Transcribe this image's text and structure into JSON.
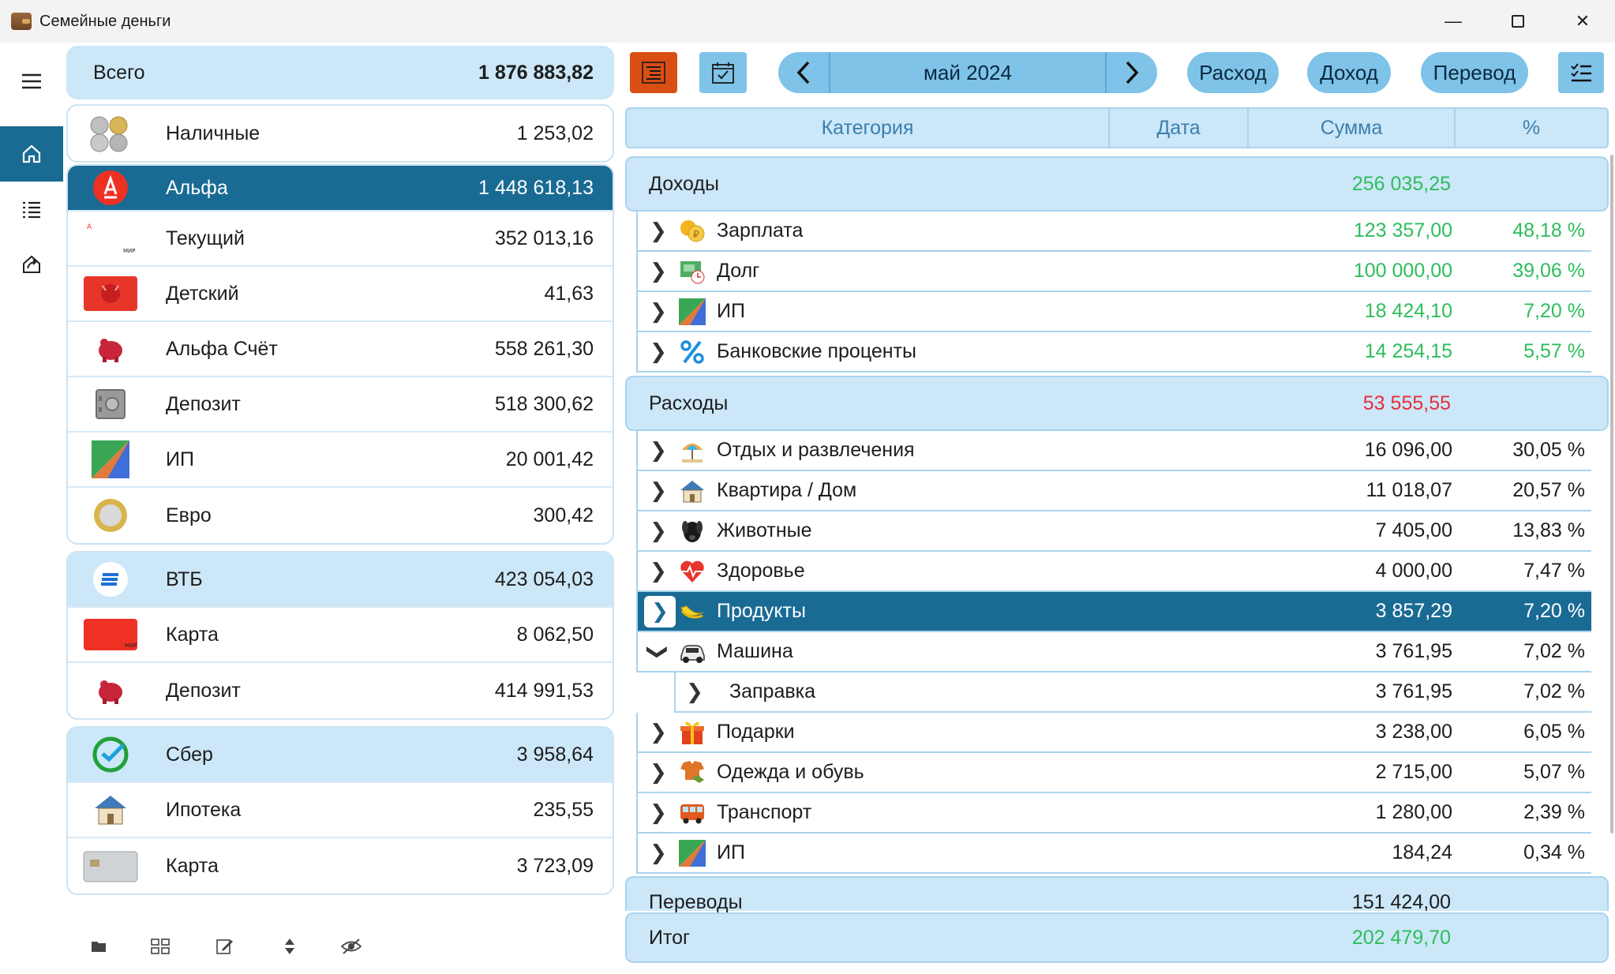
{
  "window": {
    "title": "Семейные деньги"
  },
  "accounts": {
    "total_label": "Всего",
    "total_value": "1 876 883,82",
    "groups": [
      {
        "rows": [
          {
            "name": "Наличные",
            "value": "1 253,02",
            "icon": "coins-icon"
          }
        ]
      },
      {
        "rows": [
          {
            "name": "Альфа",
            "value": "1 448 618,13",
            "icon": "alfa-bank-logo-icon",
            "bank": true,
            "selected": true
          },
          {
            "name": "Текущий",
            "value": "352 013,16",
            "icon": "card-icon"
          },
          {
            "name": "Детский",
            "value": "41,63",
            "icon": "red-cat-card-icon"
          },
          {
            "name": "Альфа Счёт",
            "value": "558 261,30",
            "icon": "piggy-bank-icon"
          },
          {
            "name": "Депозит",
            "value": "518 300,62",
            "icon": "safe-icon"
          },
          {
            "name": "ИП",
            "value": "20 001,42",
            "icon": "ip-triangle-icon"
          },
          {
            "name": "Евро",
            "value": "300,42",
            "icon": "euro-coin-icon"
          }
        ]
      },
      {
        "rows": [
          {
            "name": "ВТБ",
            "value": "423 054,03",
            "icon": "vtb-logo-icon",
            "bank": true
          },
          {
            "name": "Карта",
            "value": "8 062,50",
            "icon": "red-card-icon"
          },
          {
            "name": "Депозит",
            "value": "414 991,53",
            "icon": "piggy-bank-icon"
          }
        ]
      },
      {
        "rows": [
          {
            "name": "Сбер",
            "value": "3 958,64",
            "icon": "sber-logo-icon",
            "bank": true
          },
          {
            "name": "Ипотека",
            "value": "235,55",
            "icon": "house-icon"
          },
          {
            "name": "Карта",
            "value": "3 723,09",
            "icon": "silver-card-icon"
          }
        ]
      }
    ]
  },
  "toolbar": {
    "period": "май 2024",
    "expense_label": "Расход",
    "income_label": "Доход",
    "transfer_label": "Перевод"
  },
  "table": {
    "headers": [
      "Категория",
      "Дата",
      "Сумма",
      "%"
    ],
    "sections": {
      "income": {
        "label": "Доходы",
        "value": "256 035,25"
      },
      "expense": {
        "label": "Расходы",
        "value": "53 555,55"
      },
      "transfers": {
        "label": "Переводы",
        "value": "151 424,00"
      },
      "total": {
        "label": "Итог",
        "value": "202 479,70"
      }
    },
    "income_rows": [
      {
        "name": "Зарплата",
        "sum": "123 357,00",
        "pct": "48,18 %",
        "icon": "coins-salary-icon"
      },
      {
        "name": "Долг",
        "sum": "100 000,00",
        "pct": "39,06 %",
        "icon": "debt-icon"
      },
      {
        "name": "ИП",
        "sum": "18 424,10",
        "pct": "7,20 %",
        "icon": "ip-triangle-icon"
      },
      {
        "name": "Банковские проценты",
        "sum": "14 254,15",
        "pct": "5,57 %",
        "icon": "percent-icon"
      }
    ],
    "expense_rows": [
      {
        "name": "Отдых и развлечения",
        "sum": "16 096,00",
        "pct": "30,05 %",
        "icon": "beach-umbrella-icon"
      },
      {
        "name": "Квартира / Дом",
        "sum": "11 018,07",
        "pct": "20,57 %",
        "icon": "house-icon"
      },
      {
        "name": "Животные",
        "sum": "7 405,00",
        "pct": "13,83 %",
        "icon": "dog-icon"
      },
      {
        "name": "Здоровье",
        "sum": "4 000,00",
        "pct": "7,47 %",
        "icon": "heart-pulse-icon"
      },
      {
        "name": "Продукты",
        "sum": "3 857,29",
        "pct": "7,20 %",
        "icon": "banana-icon",
        "selected": true
      },
      {
        "name": "Машина",
        "sum": "3 761,95",
        "pct": "7,02 %",
        "icon": "car-icon",
        "expanded": true
      },
      {
        "name": "Заправка",
        "sum": "3 761,95",
        "pct": "7,02 %",
        "icon": "",
        "sub": true
      },
      {
        "name": "Подарки",
        "sum": "3 238,00",
        "pct": "6,05 %",
        "icon": "gift-icon"
      },
      {
        "name": "Одежда и обувь",
        "sum": "2 715,00",
        "pct": "5,07 %",
        "icon": "clothes-icon"
      },
      {
        "name": "Транспорт",
        "sum": "1 280,00",
        "pct": "2,39 %",
        "icon": "bus-icon"
      },
      {
        "name": "ИП",
        "sum": "184,24",
        "pct": "0,34 %",
        "icon": "ip-triangle-icon"
      }
    ]
  },
  "colors": {
    "accent": "#1a6b94",
    "light_blue": "#cce7f8",
    "button_blue": "#7fc3e8",
    "orange_button": "#d94e12",
    "income_green": "#2ebd5c",
    "expense_red": "#e62e3a"
  }
}
